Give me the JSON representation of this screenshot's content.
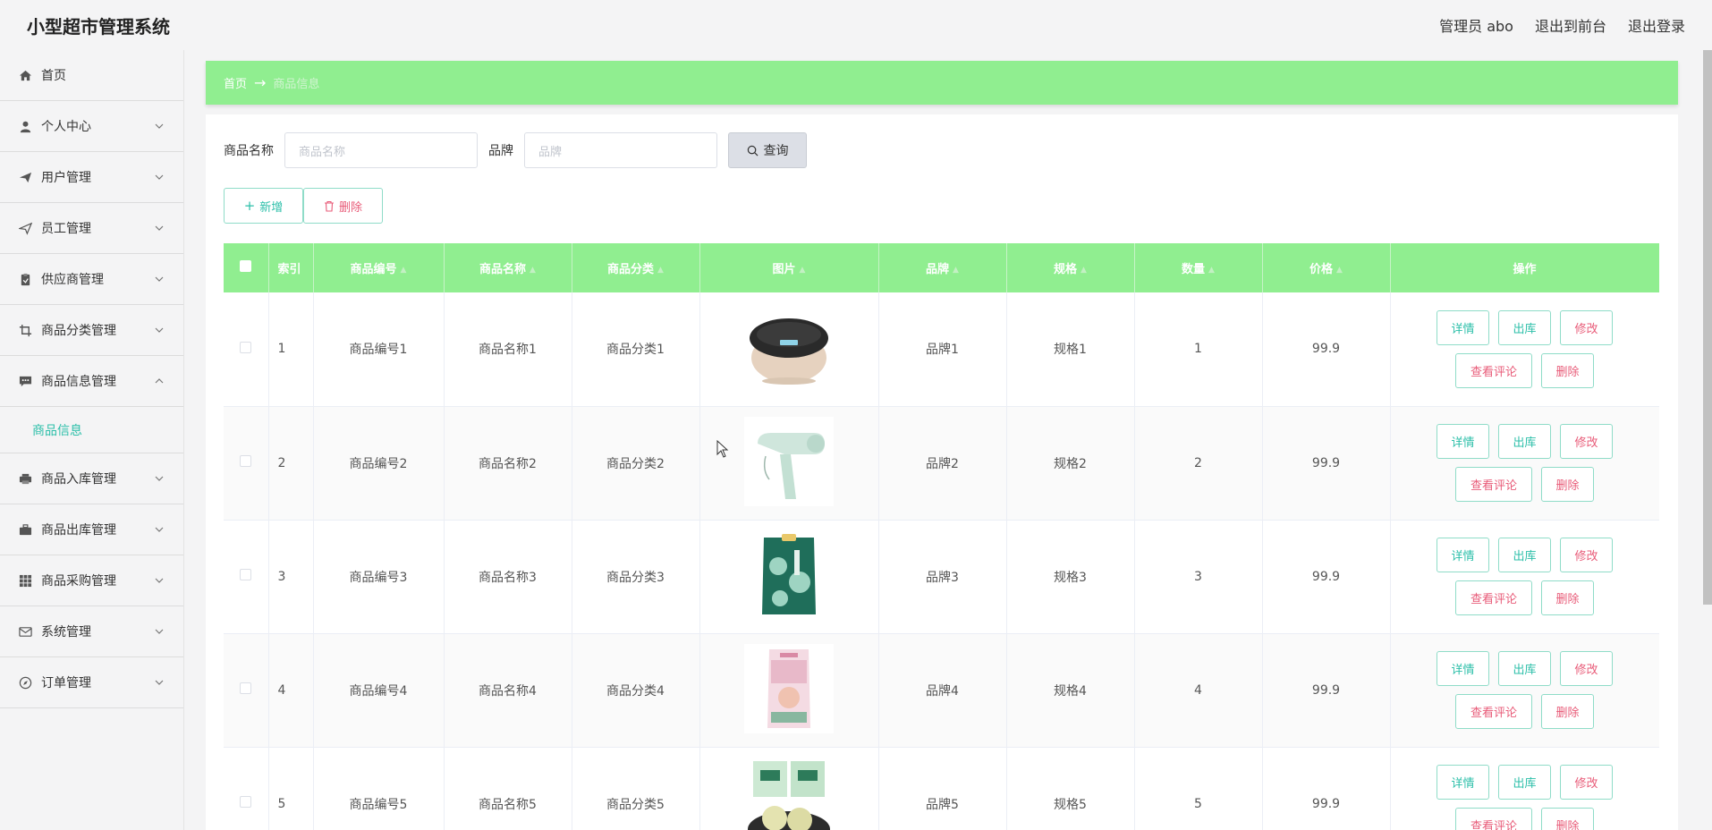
{
  "header": {
    "title": "小型超市管理系统",
    "admin": "管理员 abo",
    "to_front": "退出到前台",
    "logout": "退出登录"
  },
  "sidebar": {
    "items": [
      {
        "label": "首页",
        "icon": "home-icon"
      },
      {
        "label": "个人中心",
        "icon": "user-icon"
      },
      {
        "label": "用户管理",
        "icon": "paper-plane-icon"
      },
      {
        "label": "员工管理",
        "icon": "send-icon"
      },
      {
        "label": "供应商管理",
        "icon": "clipboard-icon"
      },
      {
        "label": "商品分类管理",
        "icon": "crop-icon"
      },
      {
        "label": "商品信息管理",
        "icon": "chat-icon"
      },
      {
        "label": "商品入库管理",
        "icon": "printer-icon"
      },
      {
        "label": "商品出库管理",
        "icon": "briefcase-icon"
      },
      {
        "label": "商品采购管理",
        "icon": "grid-icon"
      },
      {
        "label": "系统管理",
        "icon": "mail-icon"
      },
      {
        "label": "订单管理",
        "icon": "compass-icon"
      }
    ],
    "submenu_active": "商品信息"
  },
  "breadcrumb": {
    "home": "首页",
    "arrow": "→",
    "current": "商品信息"
  },
  "search": {
    "name_label": "商品名称",
    "name_placeholder": "商品名称",
    "brand_label": "品牌",
    "brand_placeholder": "品牌",
    "button": "查询"
  },
  "actions": {
    "add": "新增",
    "delete": "删除"
  },
  "table": {
    "headers": [
      "索引",
      "商品编号",
      "商品名称",
      "商品分类",
      "图片",
      "品牌",
      "规格",
      "数量",
      "价格",
      "操作"
    ],
    "rows": [
      {
        "index": "1",
        "code": "商品编号1",
        "name": "商品名称1",
        "category": "商品分类1",
        "image": "rice-cooker",
        "brand": "品牌1",
        "spec": "规格1",
        "qty": "1",
        "price": "99.9"
      },
      {
        "index": "2",
        "code": "商品编号2",
        "name": "商品名称2",
        "category": "商品分类2",
        "image": "hair-dryer",
        "brand": "品牌2",
        "spec": "规格2",
        "qty": "2",
        "price": "99.9"
      },
      {
        "index": "3",
        "code": "商品编号3",
        "name": "商品名称3",
        "category": "商品分类3",
        "image": "rice-bag",
        "brand": "品牌3",
        "spec": "规格3",
        "qty": "3",
        "price": "99.9"
      },
      {
        "index": "4",
        "code": "商品编号4",
        "name": "商品名称4",
        "category": "商品分类4",
        "image": "snack-bag",
        "brand": "品牌4",
        "spec": "规格4",
        "qty": "4",
        "price": "99.9"
      },
      {
        "index": "5",
        "code": "商品编号5",
        "name": "商品名称5",
        "category": "商品分类5",
        "image": "mooncakes",
        "brand": "品牌5",
        "spec": "规格5",
        "qty": "5",
        "price": "99.9"
      }
    ],
    "ops": {
      "detail": "详情",
      "out": "出库",
      "edit": "修改",
      "reviews": "查看评论",
      "delete": "删除"
    }
  },
  "colors": {
    "accent_green": "#90ee90",
    "teal": "#2cbfa9",
    "pink": "#e85b78"
  }
}
